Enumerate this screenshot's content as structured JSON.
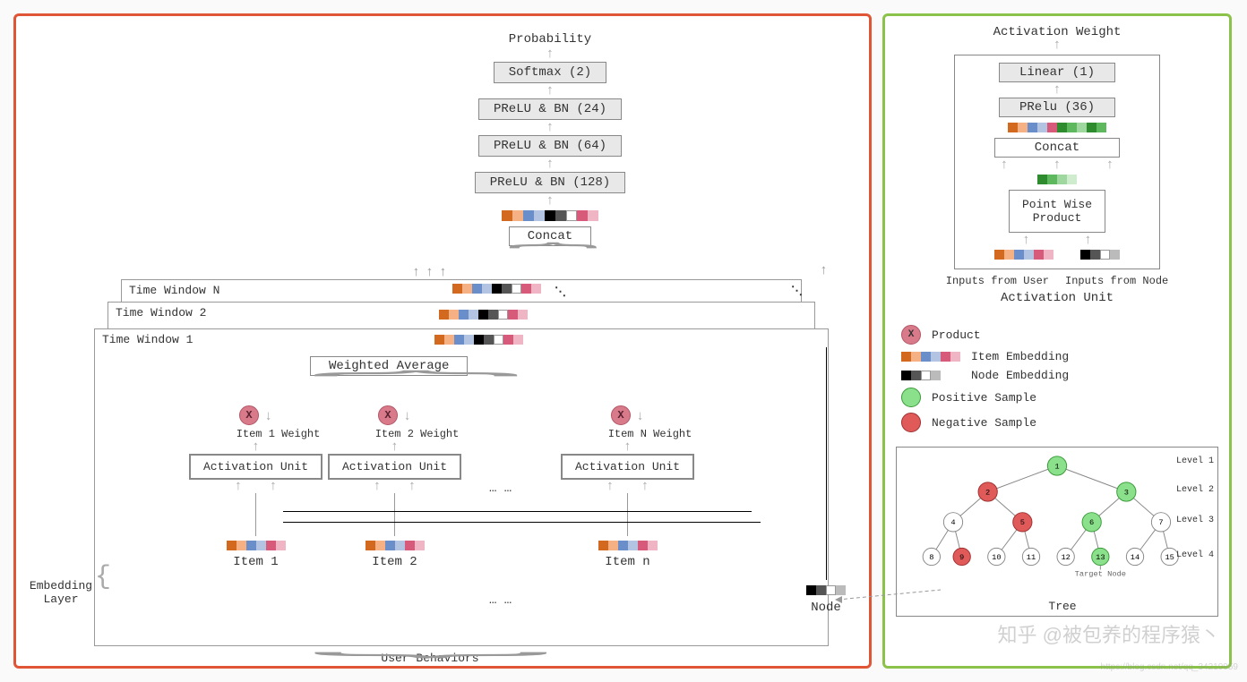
{
  "left": {
    "top_label": "Probability",
    "layers": [
      "Softmax (2)",
      "PReLU & BN (24)",
      "PReLU & BN (64)",
      "PReLU & BN (128)"
    ],
    "concat": "Concat",
    "time_windows": [
      "Time Window N",
      "Time Window 2",
      "Time Window 1"
    ],
    "weighted_avg": "Weighted Average",
    "activation_unit": "Activation Unit",
    "items": [
      {
        "name": "Item 1",
        "weight": "Item 1 Weight"
      },
      {
        "name": "Item 2",
        "weight": "Item 2 Weight"
      },
      {
        "name": "Item n",
        "weight": "Item N Weight"
      }
    ],
    "ellipsis": "…  …",
    "embedding_layer": "Embedding\nLayer",
    "user_behaviors": "User Behaviors",
    "node": "Node"
  },
  "right": {
    "top_label": "Activation Weight",
    "linear": "Linear (1)",
    "prelu": "PRelu (36)",
    "concat": "Concat",
    "point_wise": "Point Wise\nProduct",
    "inputs_user": "Inputs from User",
    "inputs_node": "Inputs from Node",
    "act_unit_label": "Activation Unit",
    "legend": {
      "product": "Product",
      "item_emb": "Item Embedding",
      "node_emb": "Node Embedding",
      "pos": "Positive Sample",
      "neg": "Negative Sample"
    },
    "tree": {
      "title": "Tree",
      "levels": [
        "Level 1",
        "Level 2",
        "Level 3",
        "Level 4"
      ],
      "target": "Target Node",
      "nodes": [
        1,
        2,
        3,
        4,
        5,
        6,
        7,
        8,
        9,
        10,
        11,
        12,
        13,
        14,
        15
      ]
    }
  },
  "watermark": "知乎 @被包养的程序猿丶",
  "watermark_url": "https://blog.csdn.net/qq_34219959"
}
